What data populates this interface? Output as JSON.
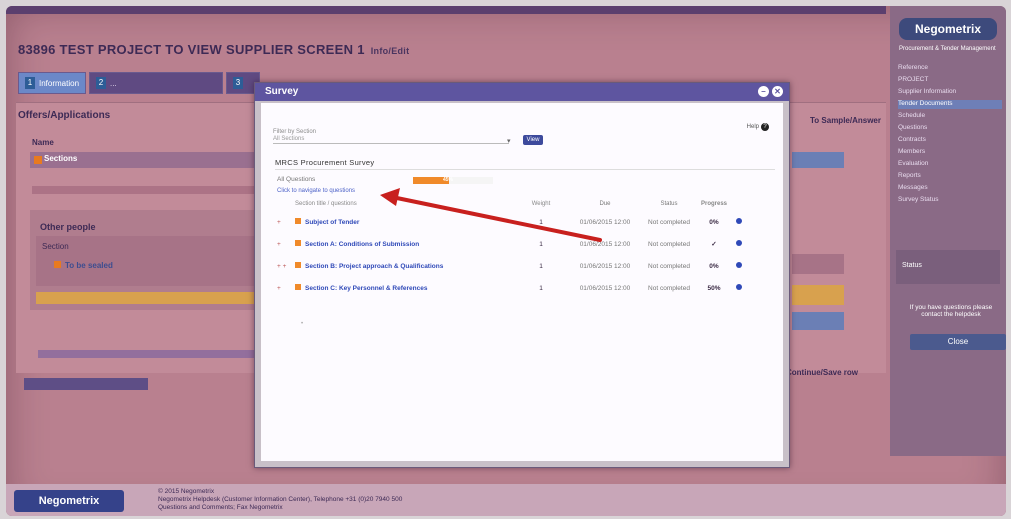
{
  "page": {
    "title": "83896 TEST PROJECT TO VIEW SUPPLIER SCREEN 1",
    "title_suffix": "Info/Edit",
    "section_heading": "Offers/Applications",
    "name_label": "Name",
    "section_row_label": "Sections",
    "other_label": "Other people",
    "other_subheading": "Section",
    "other_item": "To be sealed",
    "right_heading": "To Sample/Answer",
    "right_bottom_text": "Continue/Save row"
  },
  "tabs": [
    {
      "num": "1",
      "label": "Information"
    },
    {
      "num": "2",
      "label": "..."
    },
    {
      "num": "3",
      "label": ""
    }
  ],
  "sidebar": {
    "logo": "Negometrix",
    "subtitle": "Procurement & Tender Management",
    "items": [
      "Reference",
      "PROJECT",
      "Supplier Information",
      "Tender Documents",
      "Schedule",
      "Questions",
      "Contracts",
      "Members",
      "Evaluation",
      "Reports",
      "Messages",
      "Survey Status"
    ],
    "active_index": 3,
    "panel_label": "Status",
    "text": "If you have questions please contact the helpdesk",
    "button": "Close"
  },
  "footer": {
    "logo": "Negometrix",
    "lines": [
      "© 2015 Negometrix",
      "Negometrix Helpdesk (Customer Information Center), Telephone +31 (0)20 7940 500",
      "Questions and Comments; Fax Negometrix"
    ]
  },
  "modal": {
    "title": "Survey",
    "close_glyph": "✕",
    "min_glyph": "–",
    "filter_label": "Filter by Section",
    "filter_value": "All Sections",
    "view_button": "View",
    "help": "Help",
    "survey_name": "MRCS Procurement Survey",
    "status_label": "All Questions",
    "progress_label": "45%",
    "progress_fraction": 0.45,
    "link": "Click to navigate to questions",
    "table": {
      "headers": [
        "Section title / questions",
        "Weight",
        "Due",
        "Status",
        "Progress"
      ],
      "rows": [
        {
          "marker": "+",
          "title": "Subject of Tender",
          "weight": "1",
          "due": "01/06/2015 12:00",
          "status": "Not completed",
          "progress": "0%"
        },
        {
          "marker": "+",
          "title": "Section A: Conditions of Submission",
          "weight": "1",
          "due": "01/06/2015 12:00",
          "status": "Not completed",
          "progress": "✓"
        },
        {
          "marker": "+ +",
          "title": "Section B: Project approach & Qualifications",
          "weight": "1",
          "due": "01/06/2015 12:00",
          "status": "Not completed",
          "progress": "0%"
        },
        {
          "marker": "+",
          "title": "Section C: Key Personnel & References",
          "weight": "1",
          "due": "01/06/2015 12:00",
          "status": "Not completed",
          "progress": "50%"
        }
      ]
    }
  },
  "colors": {
    "screen_bg": "#b9808f",
    "modal_header": "#5e55a0",
    "accent_orange": "#f08a2a",
    "link_blue": "#2f49b8",
    "annotation_arrow": "#c8201e"
  }
}
